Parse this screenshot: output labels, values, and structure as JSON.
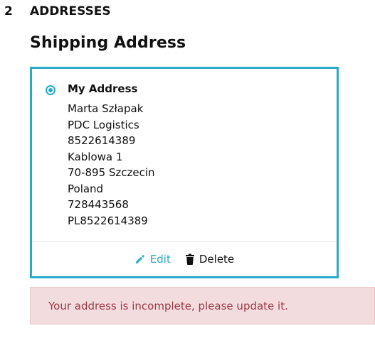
{
  "step": {
    "number": "2",
    "title": "ADDRESSES"
  },
  "section": {
    "title": "Shipping Address"
  },
  "address_card": {
    "selected": true,
    "name": "My Address",
    "lines": [
      "Marta Szłapak",
      "PDC Logistics",
      "8522614389",
      "Kablowa 1",
      "70-895 Szczecin",
      "Poland",
      "728443568",
      "PL8522614389"
    ],
    "actions": {
      "edit_label": "Edit",
      "delete_label": "Delete"
    }
  },
  "alert": {
    "message": "Your address is incomplete, please update it."
  },
  "colors": {
    "accent": "#2aaacb",
    "alert_bg": "#f3dcde",
    "alert_text": "#9a3b44"
  },
  "icons": {
    "edit": "pencil-icon",
    "delete": "trash-icon"
  }
}
